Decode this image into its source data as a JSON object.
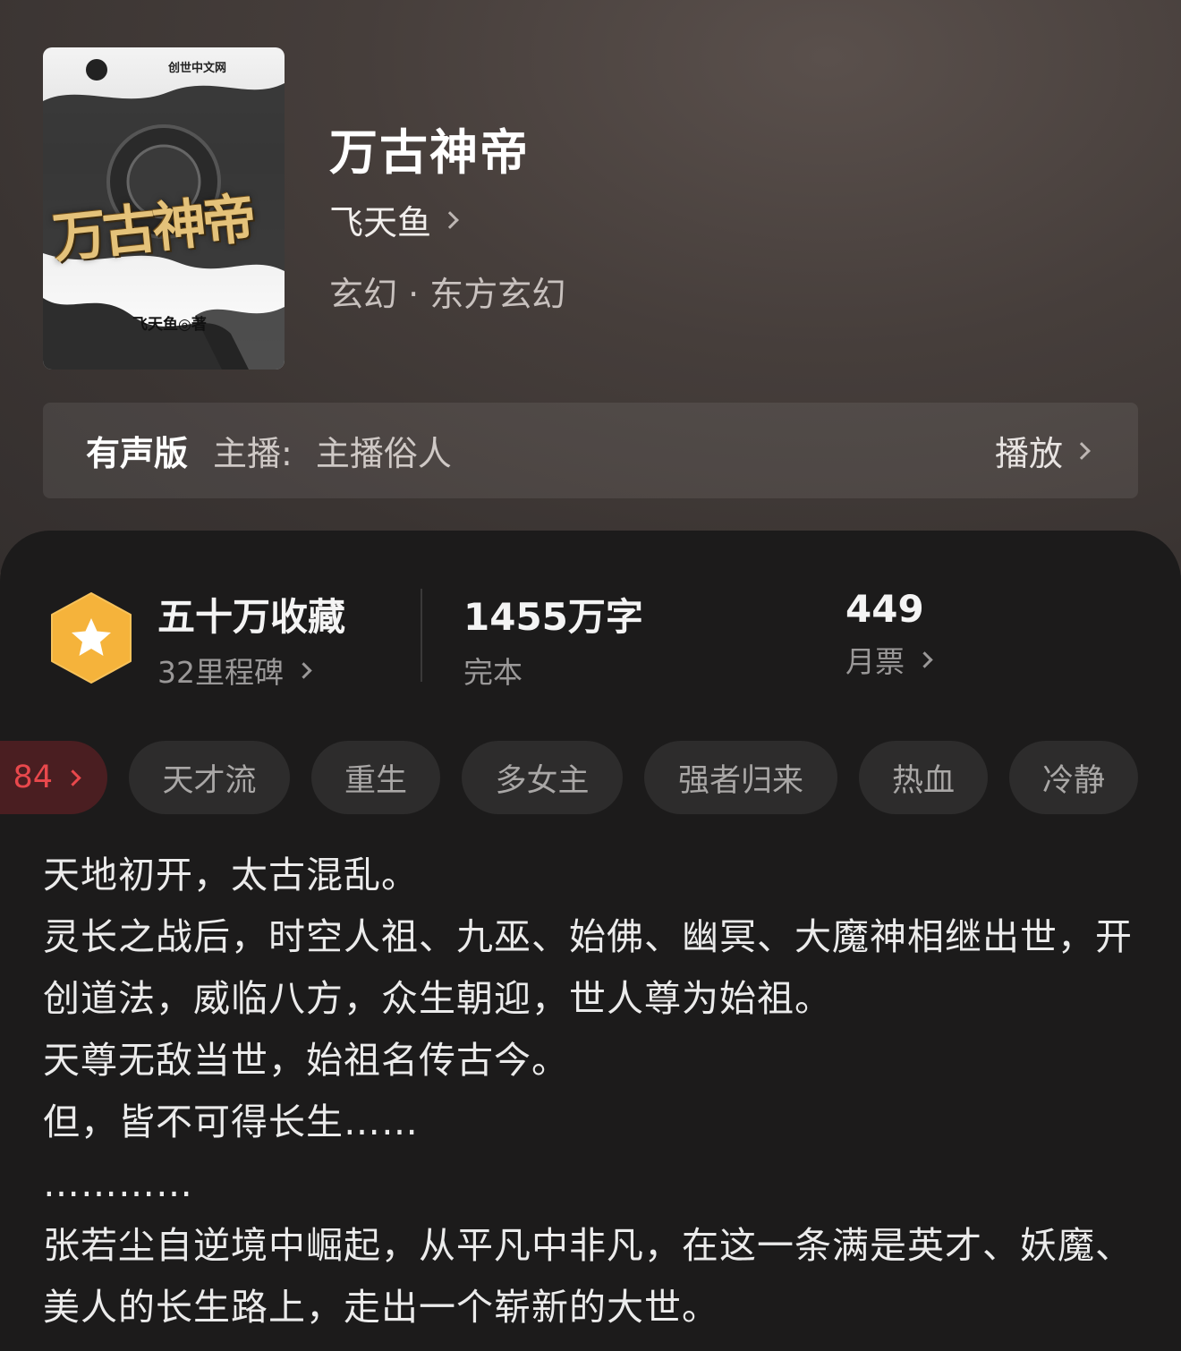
{
  "book": {
    "cover": {
      "publisher": "创世中文网",
      "title": "万古神帝",
      "author_credit": "飞天鱼◎著"
    },
    "title": "万古神帝",
    "author": "飞天鱼",
    "genre": "玄幻 · 东方玄幻"
  },
  "audio": {
    "label": "有声版",
    "host_label": "主播:",
    "host_name": "主播俗人",
    "play_label": "播放"
  },
  "stats": {
    "collections": "五十万收藏",
    "milestones": "32里程碑",
    "word_count": "1455万字",
    "status": "完本",
    "monthly_votes": "449",
    "monthly_votes_label": "月票"
  },
  "tags": {
    "rank": "84",
    "items": [
      "天才流",
      "重生",
      "多女主",
      "强者归来",
      "热血",
      "冷静"
    ]
  },
  "synopsis": [
    "天地初开，太古混乱。",
    "灵长之战后，时空人祖、九巫、始佛、幽冥、大魔神相继出世，开创道法，威临八方，众生朝迎，世人尊为始祖。",
    "天尊无敌当世，始祖名传古今。",
    "但，皆不可得长生……",
    "…………",
    "张若尘自逆境中崛起，从平凡中非凡，在这一条满是英才、妖魔、美人的长生路上，走出一个崭新的大世。"
  ],
  "colors": {
    "panel_bg": "#1c1b1b",
    "badge_gold": "#f5b33b",
    "rank_red": "#e8484c",
    "tag_bg": "#2d2c2c"
  }
}
